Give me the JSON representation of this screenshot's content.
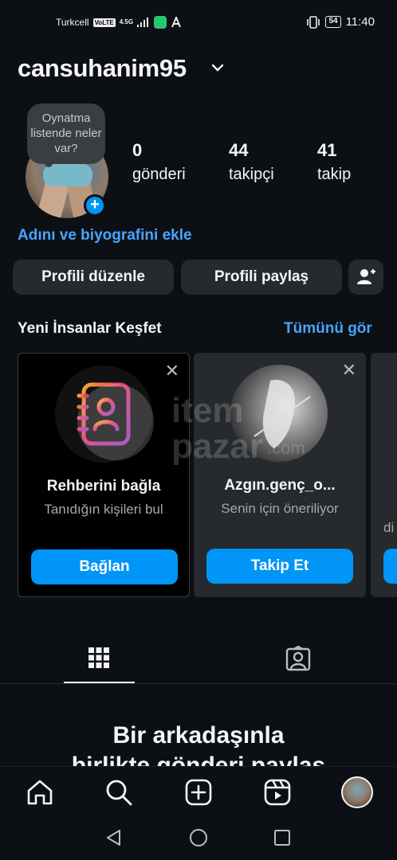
{
  "status_bar": {
    "carrier": "Turkcell",
    "volte": "VoLTE",
    "network": "4.5G",
    "battery": "54",
    "time": "11:40"
  },
  "header": {
    "username": "cansuhanim95"
  },
  "profile": {
    "note_text": "Oynatma listende neler var?",
    "stats": [
      {
        "value": "0",
        "label": "gönderi"
      },
      {
        "value": "44",
        "label": "takipçi"
      },
      {
        "value": "41",
        "label": "takip"
      }
    ],
    "bio_link": "Adını ve biyografini ekle"
  },
  "buttons": {
    "edit_profile": "Profili düzenle",
    "share_profile": "Profili paylaş"
  },
  "discover": {
    "title": "Yeni İnsanlar Keşfet",
    "see_all": "Tümünü gör",
    "cards": [
      {
        "title": "Rehberini bağla",
        "subtitle": "Tanıdığın kişileri bul",
        "button": "Bağlan"
      },
      {
        "title": "Azgın.genç_o...",
        "subtitle": "Senin için öneriliyor",
        "button": "Takip Et"
      },
      {
        "subtitle_partial": "di"
      }
    ]
  },
  "watermark": {
    "line1": "item",
    "line2": "pazar",
    "suffix": ".com"
  },
  "empty_state": {
    "title_line1": "Bir arkadaşınla",
    "title_line2": "birlikte gönderi paylaş"
  },
  "colors": {
    "background": "#0c1014",
    "accent": "#0095f6",
    "link": "#4aa3ff",
    "button_gray": "#26292e"
  }
}
